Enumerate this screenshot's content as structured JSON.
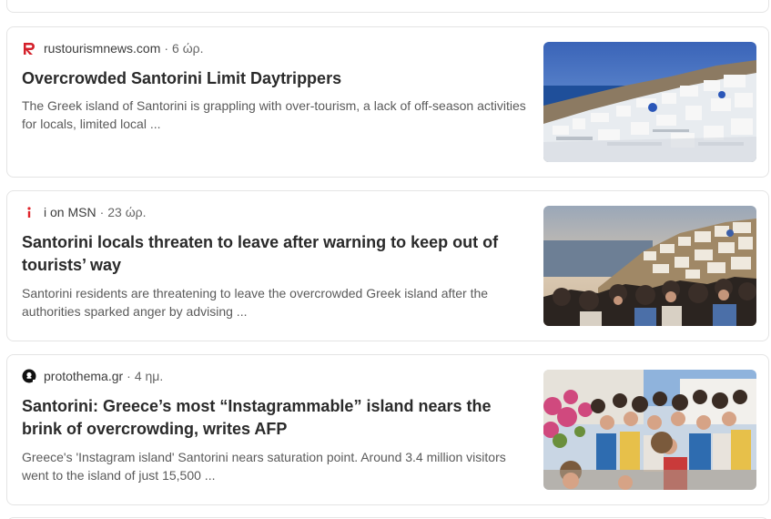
{
  "articles": [
    {
      "source": "rustourismnews.com",
      "separator": "·",
      "time": "6 ώρ.",
      "icon": "red-r-logo-icon",
      "headline": "Overcrowded Santorini Limit Daytrippers",
      "snippet": "The Greek island of Santorini is grappling with over-tourism, a lack of off-season activities for locals, limited local ...",
      "image": "santorini-whitewashed-village-photo"
    },
    {
      "source": "i on MSN",
      "separator": "·",
      "time": "23 ώρ.",
      "icon": "red-i-logo-icon",
      "headline": "Santorini locals threaten to leave after warning to keep out of tourists’ way",
      "snippet": "Santorini residents are threatening to leave the overcrowded Greek island after the authorities sparked anger by advising ...",
      "image": "santorini-crowd-sunset-photo"
    },
    {
      "source": "protothema.gr",
      "separator": "·",
      "time": "4 ημ.",
      "icon": "black-circle-logo-icon",
      "headline": "Santorini: Greece’s most “Instagrammable” island nears the brink of overcrowding, writes AFP",
      "snippet": "Greece's 'Instagram island' Santorini nears saturation point. Around 3.4 million visitors went to the island of just 15,500 ...",
      "image": "santorini-crowded-street-photo"
    }
  ],
  "colors": {
    "card_border": "#e4e4e4",
    "headline": "#2a2a2a",
    "snippet": "#5a5a5a",
    "source_r_logo": "#d4202a",
    "source_i_logo": "#e0242b",
    "source_proto_logo": "#111111"
  }
}
